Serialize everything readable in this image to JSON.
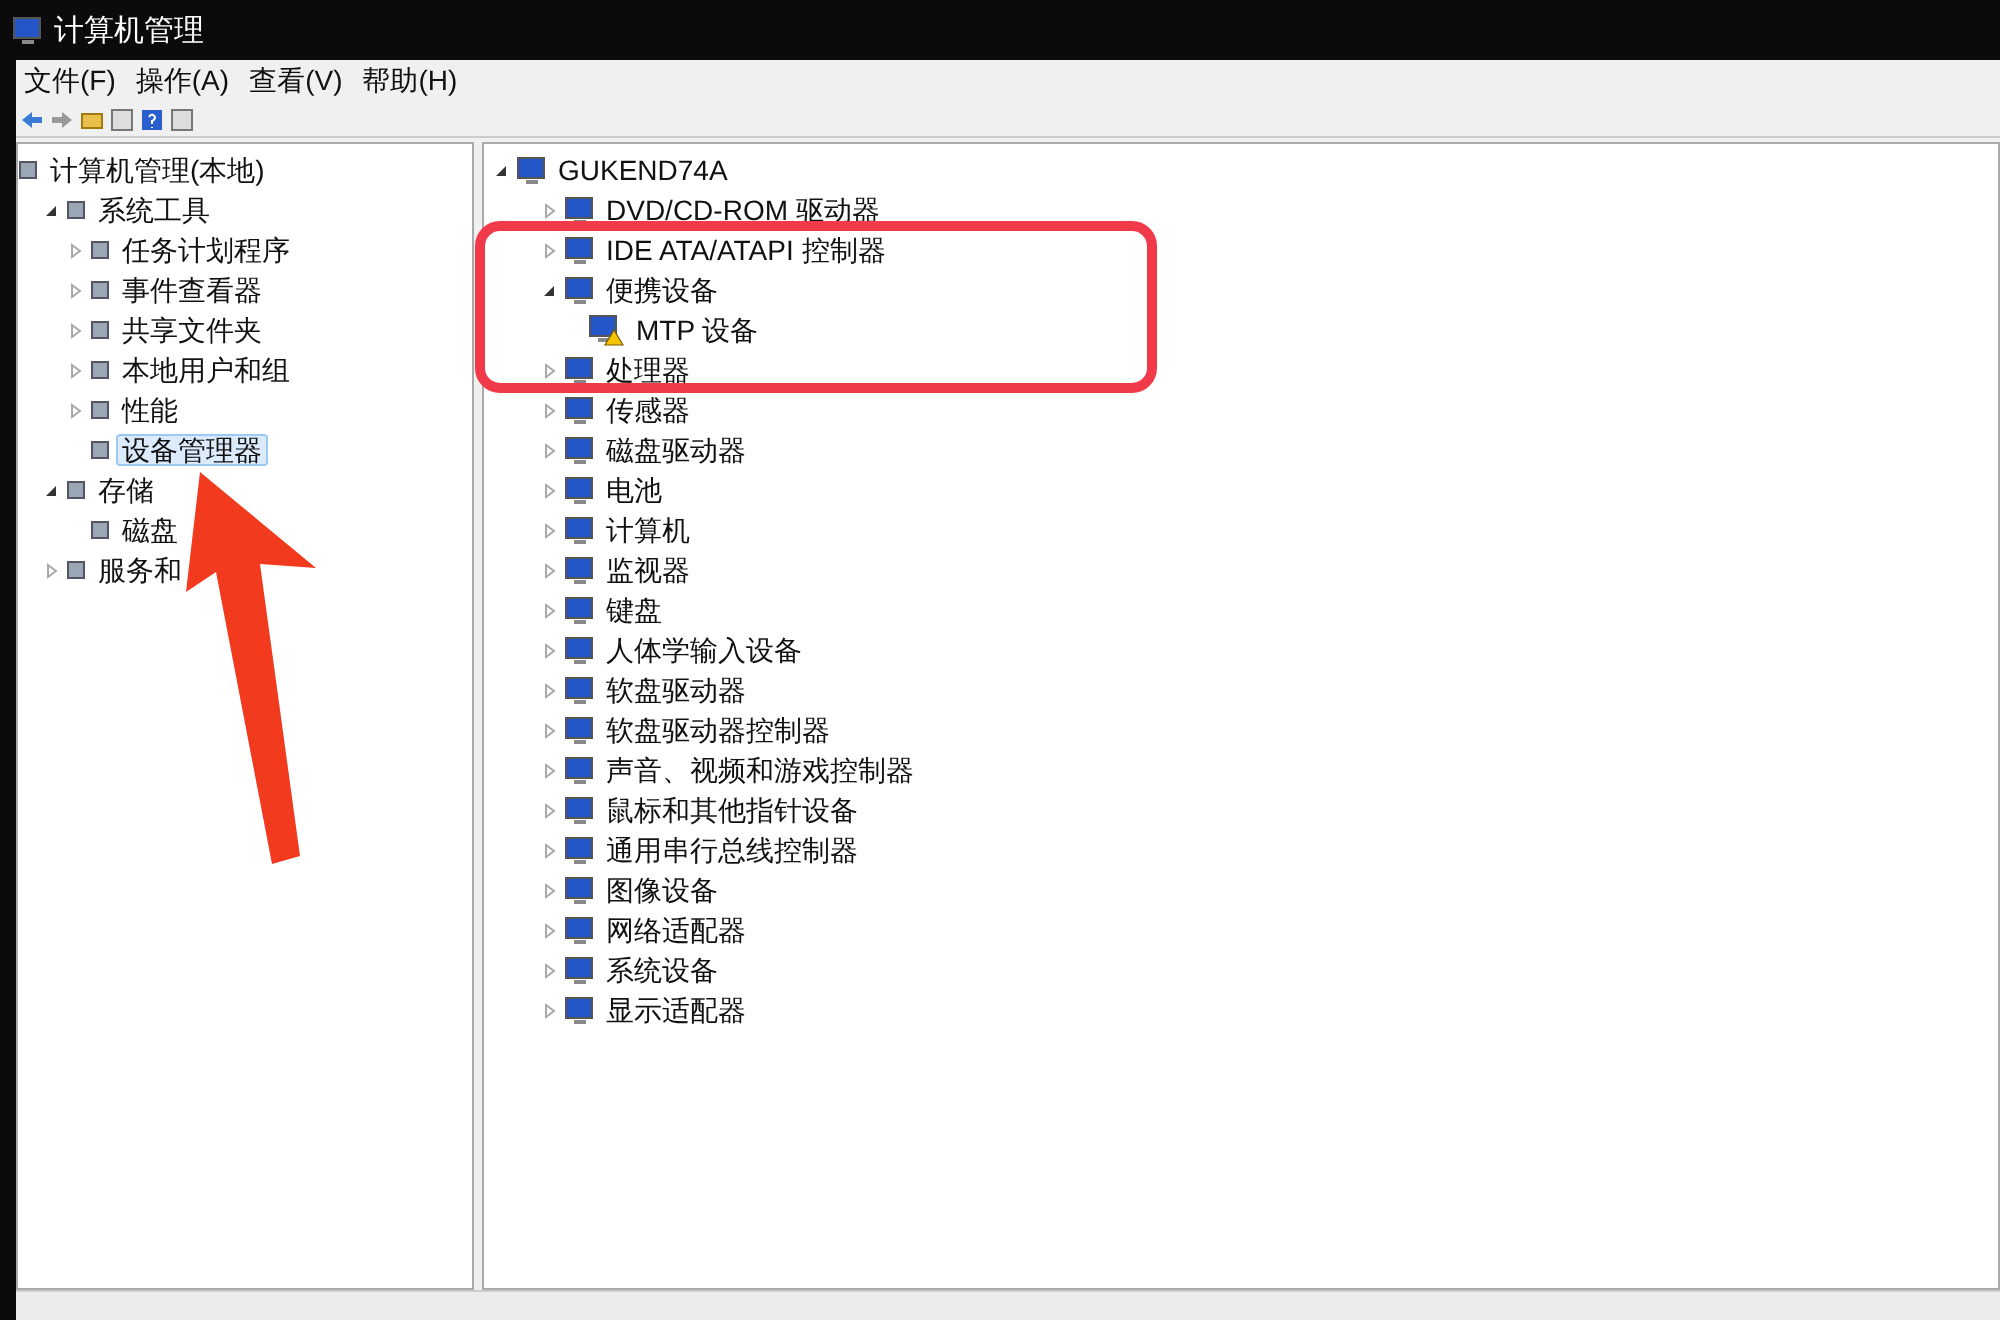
{
  "window": {
    "title": "计算机管理"
  },
  "menu": [
    "文件(F)",
    "操作(A)",
    "查看(V)",
    "帮助(H)"
  ],
  "left_tree": [
    {
      "label": "计算机管理(本地)",
      "selected": false,
      "children": [
        {
          "label": "系统工具",
          "expanded": true,
          "selected": false,
          "children": [
            {
              "label": "任务计划程序",
              "expanded": false,
              "selected": false
            },
            {
              "label": "事件查看器",
              "expanded": false,
              "selected": false
            },
            {
              "label": "共享文件夹",
              "expanded": false,
              "selected": false
            },
            {
              "label": "本地用户和组",
              "expanded": false,
              "selected": false
            },
            {
              "label": "性能",
              "expanded": false,
              "selected": false
            },
            {
              "label": "设备管理器",
              "selected": true
            }
          ]
        },
        {
          "label": "存储",
          "expanded": true,
          "selected": false,
          "children": [
            {
              "label": "磁盘",
              "selected": false
            }
          ]
        },
        {
          "label": "服务和",
          "expanded": false,
          "selected": false
        }
      ]
    }
  ],
  "device_tree": [
    {
      "label": "GUKEND74A",
      "expanded": true,
      "children": [
        {
          "label": "DVD/CD-ROM 驱动器",
          "expanded": false
        },
        {
          "label": "IDE ATA/ATAPI 控制器",
          "expanded": false
        },
        {
          "label": "便携设备",
          "expanded": true,
          "children": [
            {
              "label": "MTP 设备",
              "warning": true
            }
          ]
        },
        {
          "label": "处理器",
          "expanded": false
        },
        {
          "label": "传感器",
          "expanded": false
        },
        {
          "label": "磁盘驱动器",
          "expanded": false
        },
        {
          "label": "电池",
          "expanded": false
        },
        {
          "label": "计算机",
          "expanded": false
        },
        {
          "label": "监视器",
          "expanded": false
        },
        {
          "label": "键盘",
          "expanded": false
        },
        {
          "label": "人体学输入设备",
          "expanded": false
        },
        {
          "label": "软盘驱动器",
          "expanded": false
        },
        {
          "label": "软盘驱动器控制器",
          "expanded": false
        },
        {
          "label": "声音、视频和游戏控制器",
          "expanded": false
        },
        {
          "label": "鼠标和其他指针设备",
          "expanded": false
        },
        {
          "label": "通用串行总线控制器",
          "expanded": false
        },
        {
          "label": "图像设备",
          "expanded": false
        },
        {
          "label": "网络适配器",
          "expanded": false
        },
        {
          "label": "系统设备",
          "expanded": false
        },
        {
          "label": "显示适配器",
          "expanded": false
        }
      ]
    }
  ]
}
